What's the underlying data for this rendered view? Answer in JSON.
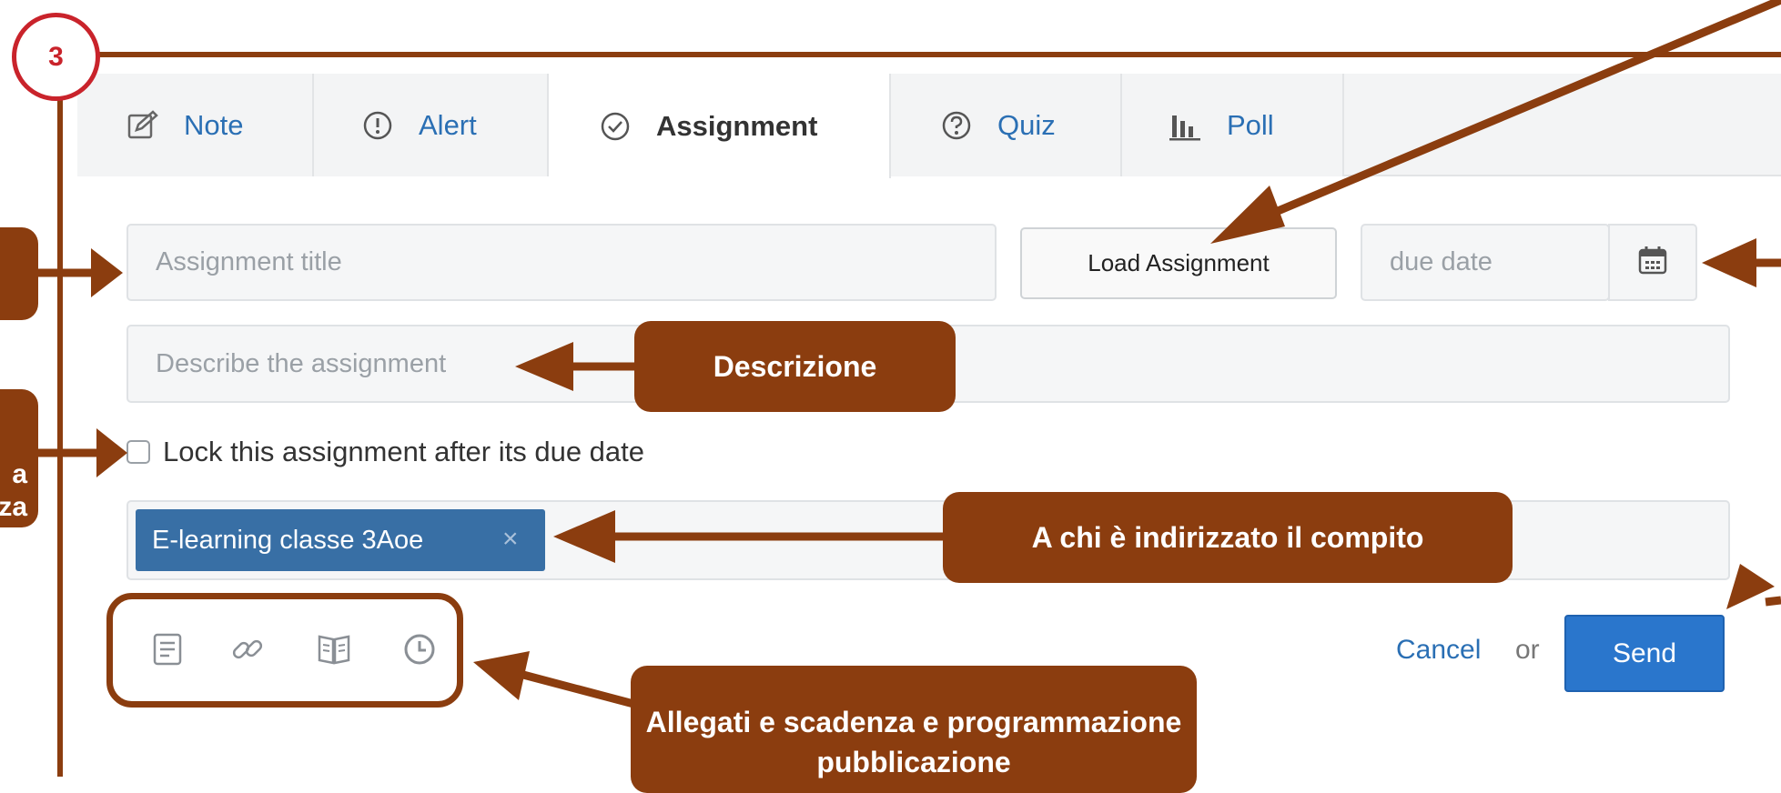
{
  "step_number": "3",
  "tabs": [
    {
      "label": "Note",
      "icon": "edit-note-icon"
    },
    {
      "label": "Alert",
      "icon": "alert-icon"
    },
    {
      "label": "Assignment",
      "icon": "check-circle-icon",
      "active": true
    },
    {
      "label": "Quiz",
      "icon": "question-icon"
    },
    {
      "label": "Poll",
      "icon": "bar-chart-icon"
    }
  ],
  "form": {
    "title_placeholder": "Assignment title",
    "load_label": "Load Assignment",
    "due_placeholder": "due date",
    "description_placeholder": "Describe the assignment",
    "lock_label": "Lock this assignment after its due date",
    "recipient_tag": "E-learning classe 3Aoe",
    "recipient_remove": "×",
    "attachment_tools": [
      "document-icon",
      "link-icon",
      "library-icon",
      "clock-icon"
    ],
    "cancel_label": "Cancel",
    "or_label": "or",
    "send_label": "Send"
  },
  "annotations": {
    "descrizione": "Descrizione",
    "destinatari": "A chi è indirizzato il compito",
    "allegati": "Allegati e scadenza e programmazione pubblicazione",
    "left_partial": "a\nza"
  },
  "colors": {
    "annotation_brown": "#8b3d0f",
    "badge_red": "#c9232b",
    "link_blue": "#2a6fb4",
    "send_blue": "#2a76cc",
    "tag_blue": "#386fa5"
  }
}
